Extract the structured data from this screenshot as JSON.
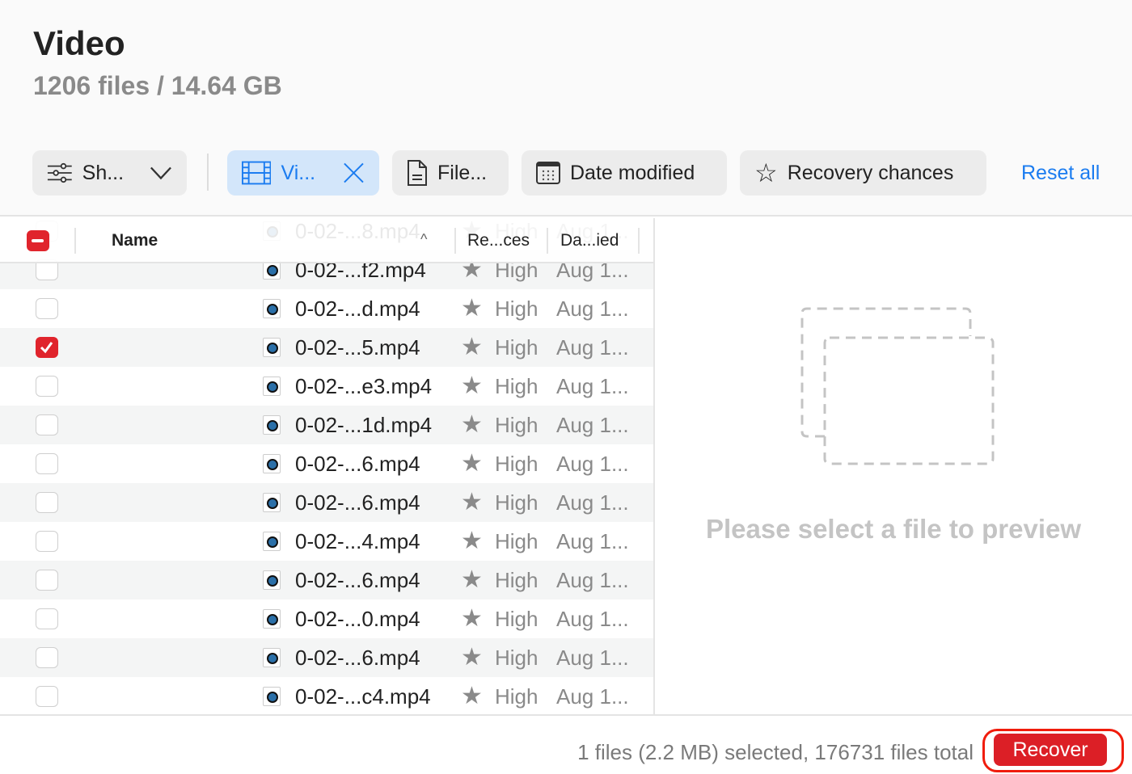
{
  "header": {
    "title": "Video",
    "subtitle": "1206 files / 14.64 GB"
  },
  "filters": {
    "show": "Sh...",
    "video": "Vi...",
    "file": "File...",
    "date": "Date modified",
    "recovery": "Recovery chances",
    "reset": "Reset all"
  },
  "table": {
    "columns": {
      "name": "Name",
      "recovery": "Re...ces",
      "date": "Da...ied"
    },
    "rows": [
      {
        "name": "0-02-...8.mp4",
        "chance": "High",
        "date": "Aug 1...",
        "checked": false
      },
      {
        "name": "0-02-...f2.mp4",
        "chance": "High",
        "date": "Aug 1...",
        "checked": false
      },
      {
        "name": "0-02-...d.mp4",
        "chance": "High",
        "date": "Aug 1...",
        "checked": false
      },
      {
        "name": "0-02-...5.mp4",
        "chance": "High",
        "date": "Aug 1...",
        "checked": true
      },
      {
        "name": "0-02-...e3.mp4",
        "chance": "High",
        "date": "Aug 1...",
        "checked": false
      },
      {
        "name": "0-02-...1d.mp4",
        "chance": "High",
        "date": "Aug 1...",
        "checked": false
      },
      {
        "name": "0-02-...6.mp4",
        "chance": "High",
        "date": "Aug 1...",
        "checked": false
      },
      {
        "name": "0-02-...6.mp4",
        "chance": "High",
        "date": "Aug 1...",
        "checked": false
      },
      {
        "name": "0-02-...4.mp4",
        "chance": "High",
        "date": "Aug 1...",
        "checked": false
      },
      {
        "name": "0-02-...6.mp4",
        "chance": "High",
        "date": "Aug 1...",
        "checked": false
      },
      {
        "name": "0-02-...0.mp4",
        "chance": "High",
        "date": "Aug 1...",
        "checked": false
      },
      {
        "name": "0-02-...6.mp4",
        "chance": "High",
        "date": "Aug 1...",
        "checked": false
      },
      {
        "name": "0-02-...c4.mp4",
        "chance": "High",
        "date": "Aug 1...",
        "checked": false
      }
    ]
  },
  "preview": {
    "message": "Please select a file to preview"
  },
  "footer": {
    "status": "1 files (2.2 MB) selected, 176731 files total",
    "recover": "Recover"
  },
  "colors": {
    "accent": "#1b7cf0",
    "danger": "#dc1f26"
  }
}
